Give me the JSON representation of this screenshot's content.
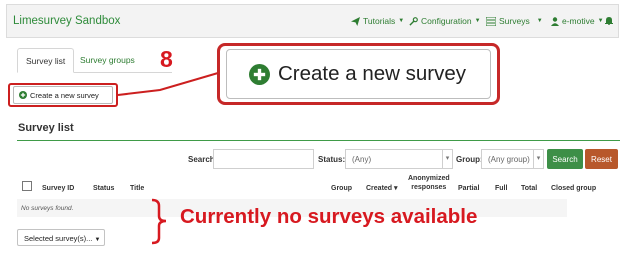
{
  "app": {
    "brand": "Limesurvey Sandbox"
  },
  "navbar": {
    "tutorials": "Tutorials",
    "configuration": "Configuration",
    "surveys": "Surveys",
    "user": "e-motive"
  },
  "tabs": [
    "Survey list",
    "Survey groups"
  ],
  "annotation": {
    "step_number": "8",
    "callout_text": "Currently no surveys available"
  },
  "create_button_label": "Create a new survey",
  "create_button_large_label": "Create a new survey",
  "survey_list": {
    "title": "Survey list",
    "filters": {
      "search_label": "Search:",
      "search_value": "",
      "status_label": "Status:",
      "status_value": "(Any)",
      "group_label": "Group:",
      "group_value": "(Any group)",
      "search_button": "Search",
      "reset_button": "Reset"
    },
    "columns": {
      "survey_id": "Survey ID",
      "status": "Status",
      "title": "Title",
      "group": "Group",
      "created": "Created",
      "anonymized_line1": "Anonymized",
      "anonymized_line2": "responses",
      "partial": "Partial",
      "full": "Full",
      "total": "Total",
      "closed_group": "Closed group"
    },
    "empty_message": "No surveys found.",
    "selected_button": "Selected survey(s)..."
  },
  "colors": {
    "brand_green": "#2e8b3a",
    "search_button": "#3d8f47",
    "reset_button": "#b8582b",
    "annotation_red": "#d71920"
  }
}
